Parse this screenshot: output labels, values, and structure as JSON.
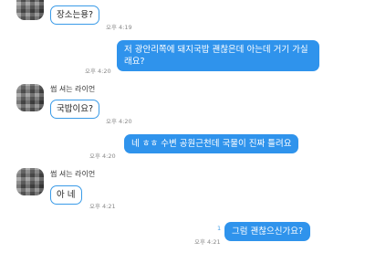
{
  "messages": [
    {
      "id": 1,
      "direction": "in",
      "text": "장소는용?",
      "time": "오후 4:19"
    },
    {
      "id": 2,
      "direction": "out",
      "text": "저 광안리쪽에 돼지국밥 괜찮은데 아는데 거기 가실래요?",
      "time": "오후 4:20"
    },
    {
      "id": 3,
      "direction": "in",
      "sender": "썹 셔는 라이언",
      "text": "국밥이요?",
      "time": "오후 4:20"
    },
    {
      "id": 4,
      "direction": "out",
      "text": "네 ㅎㅎ 수변 공원근천데 국물이 진짜 틀려요",
      "time": "오후 4:20"
    },
    {
      "id": 5,
      "direction": "in",
      "sender": "썹 셔는 라이언",
      "text": "아 네",
      "time": "오후 4:21"
    },
    {
      "id": 6,
      "direction": "out",
      "text": "그럼 괜찮으신가요?",
      "time": "오후 4:21",
      "unread": "1"
    }
  ],
  "colors": {
    "accent": "#2f93ec",
    "incoming_border": "#3a9be8",
    "background": "#ffffff"
  }
}
